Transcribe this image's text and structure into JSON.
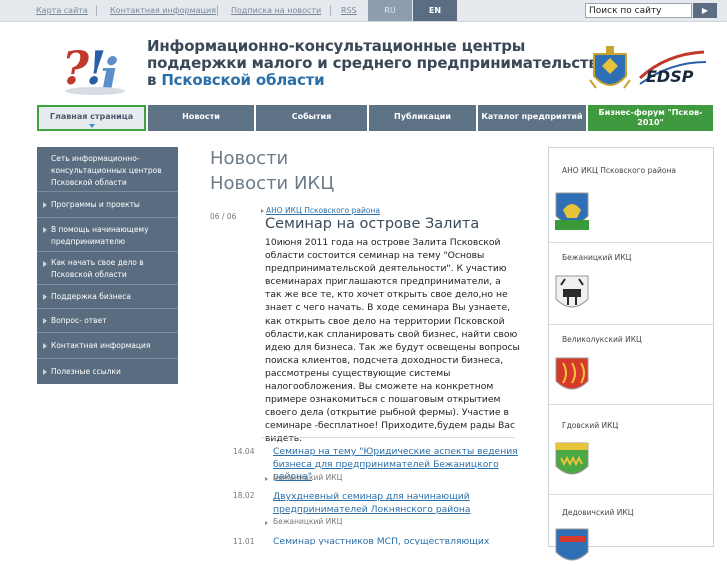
{
  "topbar": {
    "links": [
      "Карта сайта",
      "Контактная информация",
      "Подписка на новости",
      "RSS"
    ],
    "lang_ru": "RU",
    "lang_en": "EN",
    "search_value": "Поиск по сайту",
    "search_button": "▶"
  },
  "header": {
    "logo_text": "?!i",
    "title_line1": "Информационно-консультационные центры",
    "title_line2": "поддержки малого и среднего предпринимательства",
    "title_line3a": "в ",
    "title_line3b": "Псковской области",
    "edsp_logo": "EDSP"
  },
  "nav": {
    "items": [
      "Главная страница",
      "Новости",
      "События",
      "Публикации",
      "Каталог предприятий"
    ],
    "forum_line1": "Бизнес-форум \"Псков-",
    "forum_line2": "2010\""
  },
  "sidebar": {
    "items": [
      "Сеть информационно-консультационных центров Псковской области",
      "Программы и проекты",
      "В помощь начинающему предпринимателю",
      "Как начать свое дело в Псковской области",
      "Поддержка бизнеса",
      "Вопрос- ответ",
      "Контактная информация",
      "Полезные ссылки"
    ]
  },
  "main": {
    "heading1": "Новости",
    "heading2": "Новости ИКЦ",
    "article": {
      "date": "06 / 06",
      "source": "АНО ИКЦ Псковского района",
      "title": "Семинар на острове Залита",
      "body": "10июня 2011 года на острове Залита Псковской области состоится семинар на тему \"Основы предпринимательской деятельности\". К участию всеминарах приглашаются предприниматели, а так же все те, кто хочет открыть свое дело,но не знает с чего начать. В ходе семинара Вы узнаете, как открыть свое дело на территории Псковской области,как спланировать свой бизнес, найти свою идею для бизнеса. Так же будут освещены вопросы поиска клиентов, подсчета доходности бизнеса, рассмотрены существующие системы налогообложения. Вы сможете на конкретном примере ознакомиться с пошаговым открытием своего дела (открытие рыбной фермы). Участие в семинаре -бесплатное! Приходите,будем рады Вас видеть."
    },
    "news": [
      {
        "date": "14.04",
        "title": "Семинар на тему \"Юридические аспекты ведения бизнеса для предпринимателей Бежаницкого района\"",
        "source": "Бежаницкий ИКЦ"
      },
      {
        "date": "18.02",
        "title": "Двухдневный семинар для начинающий предпринимателей Локнянского района",
        "source": "Бежаницкий ИКЦ"
      },
      {
        "date": "11.01",
        "title": "Семинар участников МСП, осуществляющих"
      }
    ]
  },
  "rightcol": {
    "items": [
      "АНО ИКЦ Псковского района",
      "Бежаницкий ИКЦ",
      "Великолукский ИКЦ",
      "Гдовский ИКЦ",
      "Дедовичский ИКЦ"
    ]
  },
  "colors": {
    "nav_bg": "#5e7286",
    "active_border": "#3ba53b",
    "link": "#2a6fa8",
    "sidebar_bg": "#5a6d80"
  }
}
